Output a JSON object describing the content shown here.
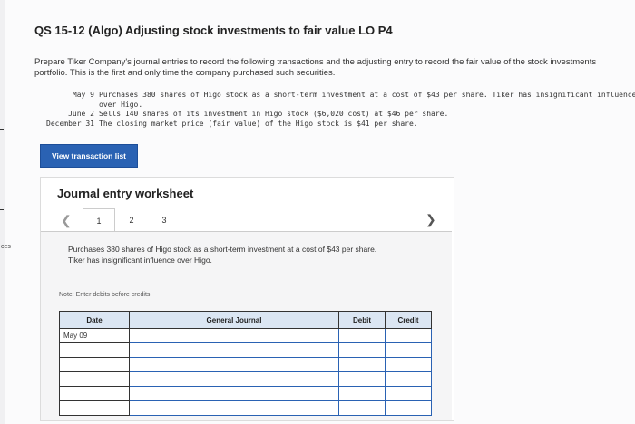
{
  "page": {
    "title": "QS 15-12 (Algo) Adjusting stock investments to fair value LO P4",
    "intro": "Prepare Tiker Company's journal entries to record the following transactions and the adjusting entry to record the fair value of the stock investments portfolio. This is the first and only time the company purchased such securities.",
    "transactions": [
      {
        "date": "May 9",
        "text": "Purchases 380 shares of Higo stock as a short-term investment at a cost of $43 per share. Tiker has insignificant influence over Higo."
      },
      {
        "date": "June 2",
        "text": "Sells 140 shares of its investment in Higo stock ($6,020 cost) at $46 per share."
      },
      {
        "date": "December 31",
        "text": "The closing market price (fair value) of the Higo stock is $41 per share."
      }
    ],
    "view_button": "View transaction list",
    "side_label": "ces"
  },
  "worksheet": {
    "title": "Journal entry worksheet",
    "pages": [
      "1",
      "2",
      "3"
    ],
    "active_page": "1",
    "step_text": "Purchases 380 shares of Higo stock as a short-term investment at a cost of $43 per share. Tiker has insignificant influence over Higo.",
    "note": "Note: Enter debits before credits.",
    "table": {
      "headers": [
        "Date",
        "General Journal",
        "Debit",
        "Credit"
      ],
      "rows": [
        {
          "date": "May 09",
          "account": "",
          "debit": "",
          "credit": ""
        },
        {
          "date": "",
          "account": "",
          "debit": "",
          "credit": ""
        },
        {
          "date": "",
          "account": "",
          "debit": "",
          "credit": ""
        },
        {
          "date": "",
          "account": "",
          "debit": "",
          "credit": ""
        },
        {
          "date": "",
          "account": "",
          "debit": "",
          "credit": ""
        },
        {
          "date": "",
          "account": "",
          "debit": "",
          "credit": ""
        }
      ]
    }
  },
  "icons": {
    "prev": "chevron-left-icon",
    "next": "chevron-right-icon"
  },
  "colors": {
    "button": "#2a62b3",
    "header_bg": "#dbe6f3",
    "input_border": "#2a62b3"
  }
}
